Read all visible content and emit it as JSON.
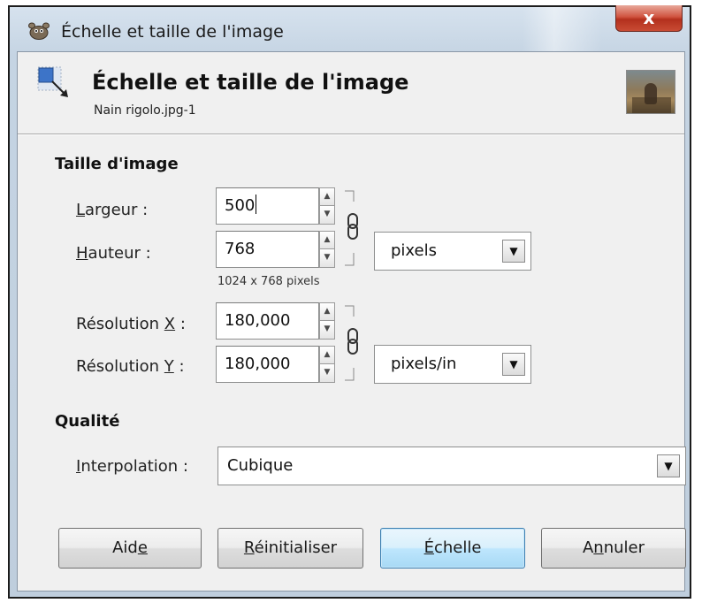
{
  "window": {
    "title": "Échelle et taille de l'image",
    "close_label": "x"
  },
  "header": {
    "title": "Échelle et taille de l'image",
    "subtitle": "Nain rigolo.jpg-1"
  },
  "image_size": {
    "section_title": "Taille d'image",
    "width_label_key": "L",
    "width_label_rest": "argeur :",
    "width_value": "500",
    "height_label_key": "H",
    "height_label_rest": "auteur :",
    "height_value": "768",
    "unit": "pixels",
    "size_info": "1024 x 768 pixels",
    "res_x_label_pre": "Résolution ",
    "res_x_label_key": "X",
    "res_x_label_post": " :",
    "res_x_value": "180,000",
    "res_y_label_pre": "Résolution ",
    "res_y_label_key": "Y",
    "res_y_label_post": " :",
    "res_y_value": "180,000",
    "res_unit": "pixels/in"
  },
  "quality": {
    "section_title": "Qualité",
    "interp_label_key": "I",
    "interp_label_rest": "nterpolation :",
    "interp_value": "Cubique"
  },
  "buttons": {
    "help_pre": "Aid",
    "help_key": "e",
    "reset_key": "R",
    "reset_rest": "éinitialiser",
    "scale_key": "É",
    "scale_rest": "chelle",
    "cancel_pre": "A",
    "cancel_key": "n",
    "cancel_rest": "nuler"
  },
  "icons": {
    "app": "gimp-icon",
    "header": "scale-image-icon",
    "chain": "chain-link-icon",
    "spin_up": "spin-up-icon",
    "spin_down": "spin-down-icon",
    "dropdown": "chevron-down-icon",
    "close": "close-icon",
    "thumbnail": "image-thumbnail"
  },
  "colors": {
    "close_button": "#c94b34",
    "default_button": "#bee6fd",
    "frame": "#c5d4e3"
  }
}
